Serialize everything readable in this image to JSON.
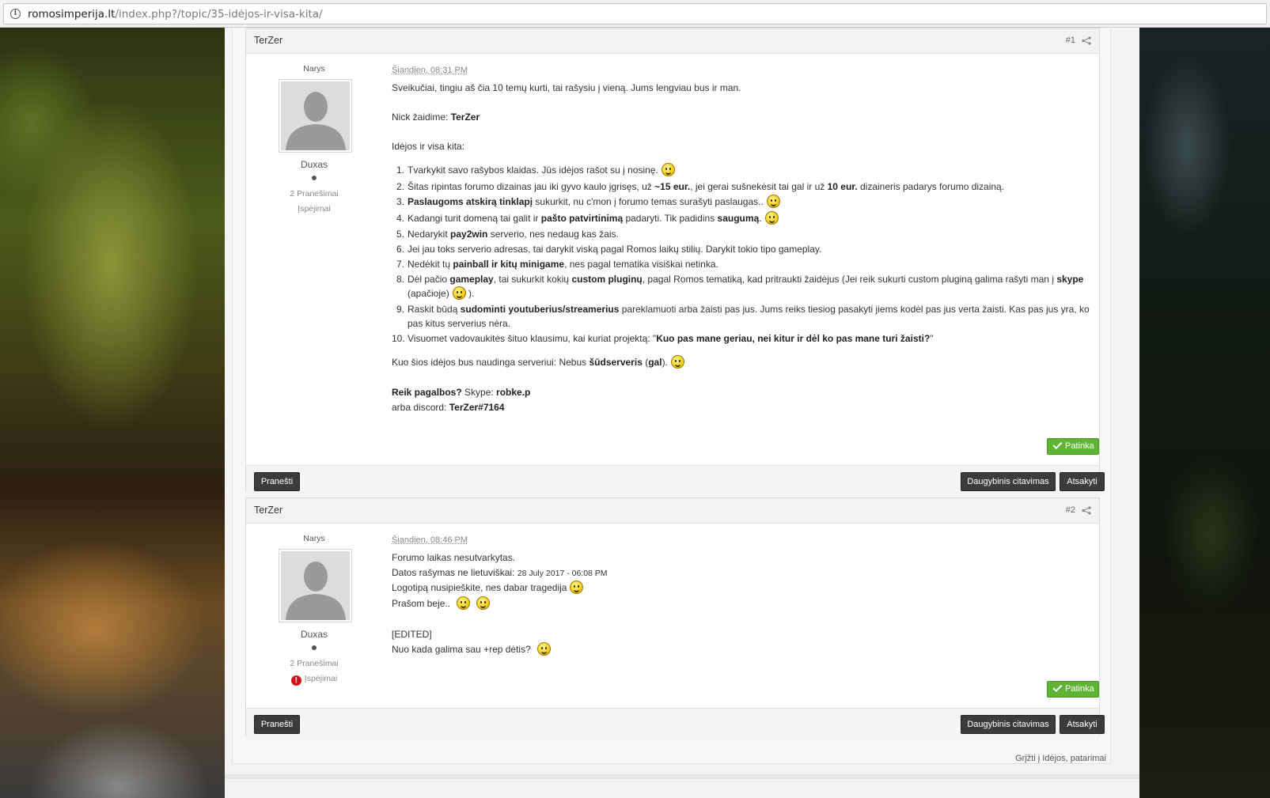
{
  "browser": {
    "url_host": "romosimperija.lt",
    "url_path": "/index.php?/topic/35-idėjos-ir-visa-kita/"
  },
  "posts": [
    {
      "author": "TerZer",
      "number": "#1",
      "group": "Narys",
      "rank": "Duxas",
      "posts_count": "2 Pranešimai",
      "warnings": "Įspėjimai",
      "date": "Šiandien, 08:31 PM",
      "intro": "Sveikučiai, tingiu aš čia 10 temų kurti, tai rašysiu į vieną. Jums lengviau bus ir man.",
      "nick_label": "Nick žaidime: ",
      "nick_value": "TerZer",
      "ideas_heading": "Idėjos ir visa kita:",
      "list": {
        "i1": "Tvarkykit savo rašybos klaidas. Jūs idėjos rašot su į nosinę.",
        "i2a": "Šitas ripintas forumo dizainas jau iki gyvo kaulo įgrisęs, už ",
        "i2b": "~15 eur.",
        "i2c": ", jei gerai sušnekėsit tai gal ir už ",
        "i2d": "10 eur.",
        "i2e": " dizaineris padarys forumo dizainą.",
        "i3a": "Paslaugoms atskirą tinklapį",
        "i3b": " sukurkit, nu c'mon į forumo temas surašyti paslaugas..",
        "i4a": "Kadangi turit domeną tai galit ir ",
        "i4b": "pašto patvirtinimą",
        "i4c": " padaryti. Tik padidins ",
        "i4d": "saugumą",
        "i4e": ".",
        "i5a": "Nedarykit ",
        "i5b": "pay2win",
        "i5c": " serverio, nes nedaug kas žais.",
        "i6": "Jei jau toks serverio adresas, tai darykit viską pagal Romos laikų stilių. Darykit tokio tipo gameplay.",
        "i7a": "Nedėkit tų ",
        "i7b": "painball ir kitų minigame",
        "i7c": ", nes pagal tematika visiškai netinka.",
        "i8a": "Dėl pačio ",
        "i8b": "gameplay",
        "i8c": ", tai sukurkit kokių ",
        "i8d": "custom pluginų",
        "i8e": ", pagal Romos tematiką, kad pritraukti žaidėjus (Jei reik sukurti custom pluginą galima rašyti man į ",
        "i8f": "skype",
        "i8g": "(apačioje)",
        "i8h": " ).",
        "i9a": "Raskit būdą ",
        "i9b": "sudominti youtuberius/streamerius",
        "i9c": " pareklamuoti arba žaisti pas jus. Jums reiks tiesiog pasakyti jiems kodėl pas jus verta žaisti. Kas pas jus yra, ko",
        "i9d": "pas kitus serverius nėra.",
        "i10a": "Visuomet vadovaukitės šituo klausimu, kai kuriat projektą: \"",
        "i10b": "Kuo pas mane geriau, nei kitur ir dėl ko pas mane turi žaisti?",
        "i10c": "\""
      },
      "usefulness_a": "Kuo šios idėjos bus naudinga serveriui: Nebus ",
      "usefulness_b": "šūdserveris",
      "usefulness_c": " (",
      "usefulness_d": "gal",
      "usefulness_e": ").",
      "help_label": "Reik pagalbos?",
      "skype_label": " Skype: ",
      "skype_value": "robke.p",
      "discord_label": "arba discord: ",
      "discord_value": "TerZer#7164",
      "like_label": "Patinka",
      "report_label": "Pranešti",
      "multiquote_label": "Daugybinis citavimas",
      "reply_label": "Atsakyti"
    },
    {
      "author": "TerZer",
      "number": "#2",
      "group": "Narys",
      "rank": "Duxas",
      "posts_count": "2 Pranešimai",
      "warnings": "Įspėjimai",
      "date": "Šiandien, 08:46 PM",
      "l1": "Forumo laikas nesutvarkytas.",
      "l2a": "Datos rašymas ne lietuviškai: ",
      "l2b": "28 July 2017 - 06:08 PM",
      "l3": "Logotipą nusipieškite, nes dabar tragedija",
      "l4": "Prašom beje..",
      "l5": "[EDITED]",
      "l6": "Nuo kada galima sau +rep dėtis?",
      "like_label": "Patinka",
      "report_label": "Pranešti",
      "multiquote_label": "Daugybinis citavimas",
      "reply_label": "Atsakyti"
    }
  ],
  "back_link": "Grįžti į Idėjos, patarimai"
}
